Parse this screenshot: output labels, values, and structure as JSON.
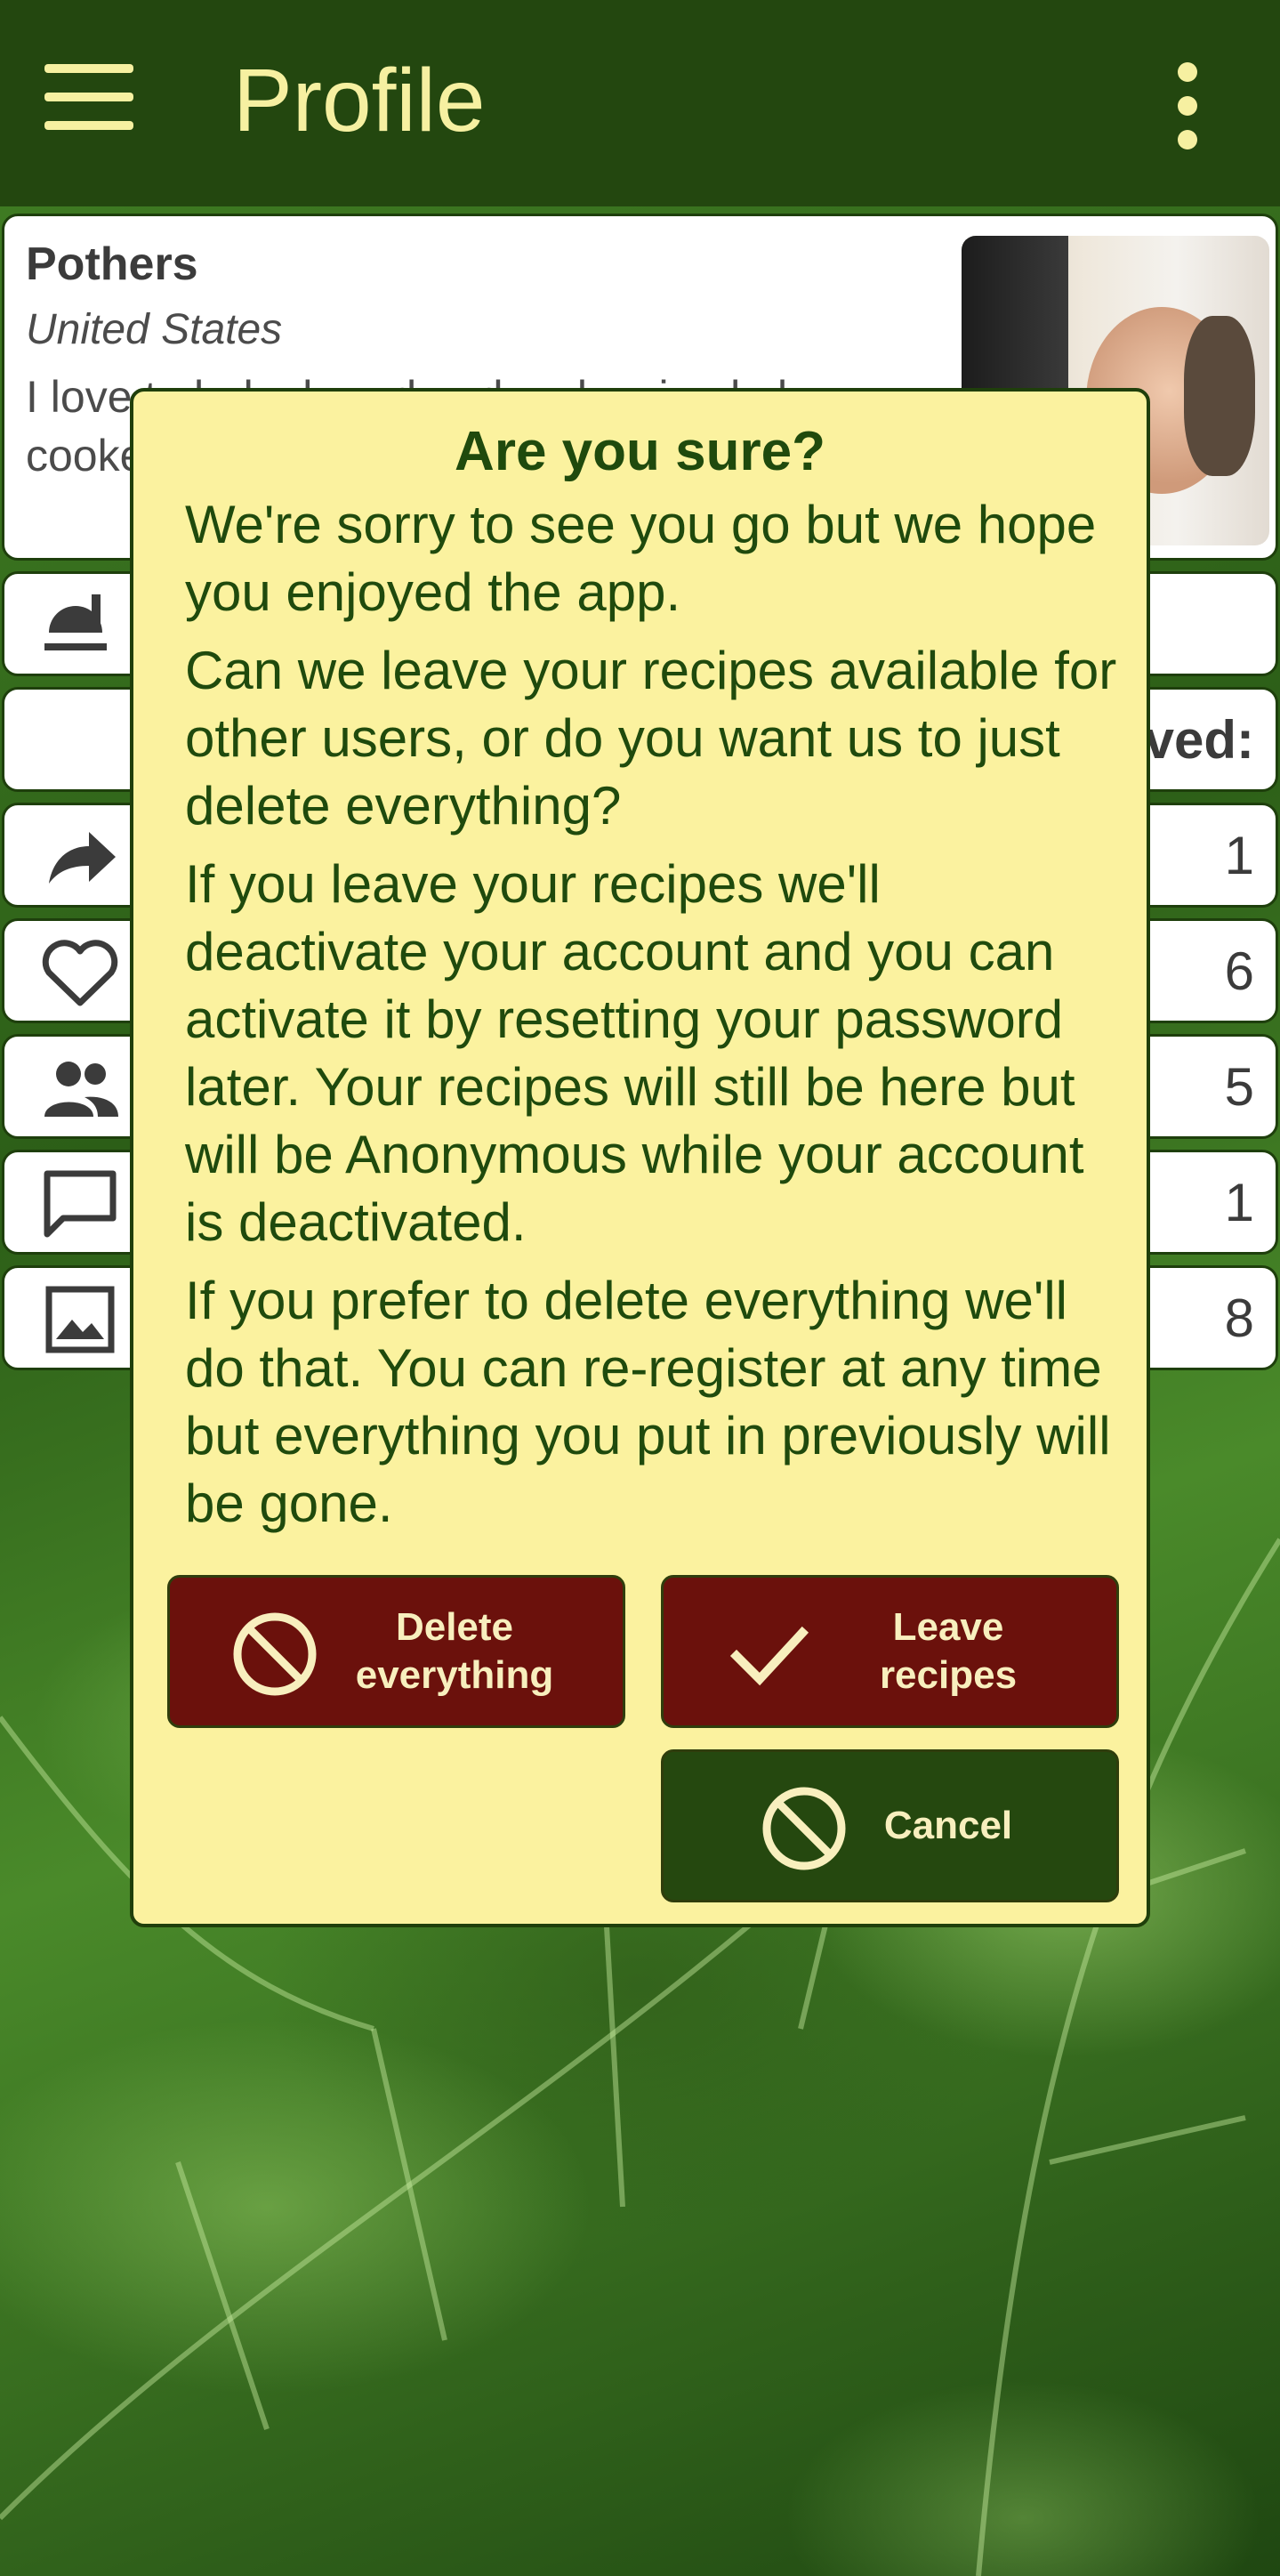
{
  "app_bar": {
    "title": "Profile",
    "menu_icon": "hamburger-menu-icon",
    "overflow_icon": "more-vert-icon"
  },
  "profile": {
    "name": "Pothers",
    "country": "United States",
    "bio": "I love to bake bread and make simple home cooked meals."
  },
  "stats": [
    {
      "icon": "recipes-icon",
      "value": ""
    },
    {
      "icon": "",
      "label": "ved:"
    },
    {
      "icon": "share-icon",
      "value": "1"
    },
    {
      "icon": "heart-icon",
      "value": "6"
    },
    {
      "icon": "people-icon",
      "value": "5"
    },
    {
      "icon": "comment-icon",
      "value": "1"
    },
    {
      "icon": "image-icon",
      "value": "8"
    }
  ],
  "dialog": {
    "title": "Are you sure?",
    "paragraphs": [
      "We're sorry to see you go but we hope you enjoyed the app.",
      "Can we leave your recipes available for other users, or do you want us to just delete everything?",
      "If you leave your recipes we'll deactivate your account and you can activate it by resetting your password later. Your recipes will still be here but will be Anonymous while your account is deactivated.",
      "If you prefer to delete everything we'll do that. You can re-register at any time but everything you put in previously will be gone."
    ],
    "delete_label_line1": "Delete",
    "delete_label_line2": "everything",
    "leave_label_line1": "Leave",
    "leave_label_line2": "recipes",
    "cancel_label": "Cancel"
  },
  "colors": {
    "app_bar": "#23470f",
    "title_text": "#f6f0a1",
    "dialog_bg": "#fbf29f",
    "dialog_text": "#1f4a0d",
    "danger_button": "#6b110c",
    "cancel_button": "#25480f"
  }
}
